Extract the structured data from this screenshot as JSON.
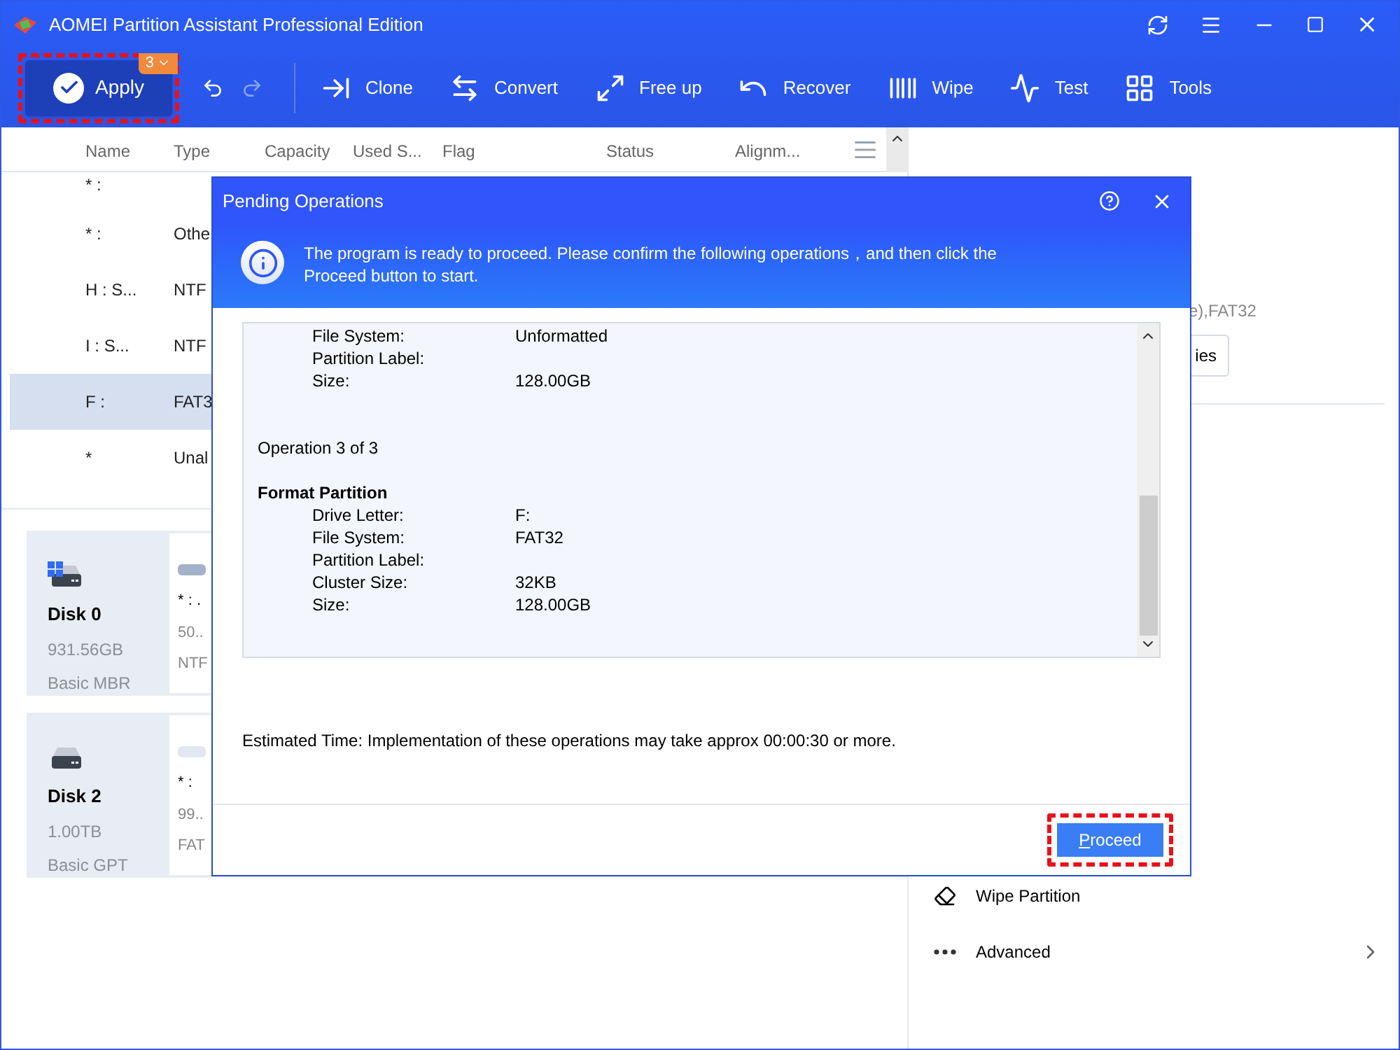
{
  "window": {
    "title": "AOMEI Partition Assistant Professional Edition"
  },
  "toolbar": {
    "apply": {
      "label": "Apply",
      "badge": "3"
    },
    "tools": [
      {
        "kind": "clone",
        "label": "Clone"
      },
      {
        "kind": "convert",
        "label": "Convert"
      },
      {
        "kind": "freeup",
        "label": "Free up"
      },
      {
        "kind": "recover",
        "label": "Recover"
      },
      {
        "kind": "wipe",
        "label": "Wipe"
      },
      {
        "kind": "test",
        "label": "Test"
      },
      {
        "kind": "tools",
        "label": "Tools"
      }
    ]
  },
  "table": {
    "columns": [
      "Name",
      "Type",
      "Capacity",
      "Used S...",
      "Flag",
      "Status",
      "Alignm..."
    ],
    "rows": [
      {
        "name": "* :",
        "selected": false
      },
      {
        "name": "* :",
        "type": "Othe",
        "selected": false
      },
      {
        "name": "H : S...",
        "type": "NTF",
        "selected": false
      },
      {
        "name": "I : S...",
        "type": "NTF",
        "selected": false
      },
      {
        "name": "F :",
        "type": "FAT3",
        "selected": true
      },
      {
        "name": "*",
        "type": "Unal",
        "selected": false
      }
    ]
  },
  "disks": [
    {
      "kind": "mbr",
      "name": "Disk 0",
      "size": "931.56GB",
      "style": "Basic MBR",
      "partition": {
        "name": "* : .",
        "size": "50..",
        "fs": "NTF"
      }
    },
    {
      "kind": "gpt",
      "name": "Disk 2",
      "size": "1.00TB",
      "style": "Basic GPT",
      "partition": {
        "name": "* :",
        "size": "99..",
        "fs": "FAT"
      }
    }
  ],
  "right_panel": {
    "info": "e),FAT32",
    "button": "ies",
    "actions": [
      {
        "kind": "wipe",
        "label": "Wipe Partition"
      },
      {
        "kind": "more",
        "label": "Advanced"
      }
    ]
  },
  "dialog": {
    "title": "Pending Operations",
    "message": "The program is ready to proceed. Please confirm the following operations，and then click the Proceed button to start.",
    "lines": [
      {
        "kind": "field",
        "label": "File System:",
        "value": "Unformatted"
      },
      {
        "kind": "field",
        "label": "Partition Label:"
      },
      {
        "kind": "field",
        "label": "Size:",
        "value": "128.00GB"
      },
      {
        "kind": "operation",
        "label": "Operation 3 of 3"
      },
      {
        "kind": "heading",
        "label": "Format Partition"
      },
      {
        "kind": "field",
        "label": "Drive Letter:",
        "value": "F:"
      },
      {
        "kind": "field",
        "label": "File System:",
        "value": "FAT32"
      },
      {
        "kind": "field",
        "label": "Partition Label:"
      },
      {
        "kind": "field",
        "label": "Cluster Size:",
        "value": "32KB"
      },
      {
        "kind": "field",
        "label": "Size:",
        "value": "128.00GB"
      }
    ],
    "estimate": "Estimated Time: Implementation of these operations may take approx 00:00:30 or more.",
    "button": "Proceed"
  }
}
